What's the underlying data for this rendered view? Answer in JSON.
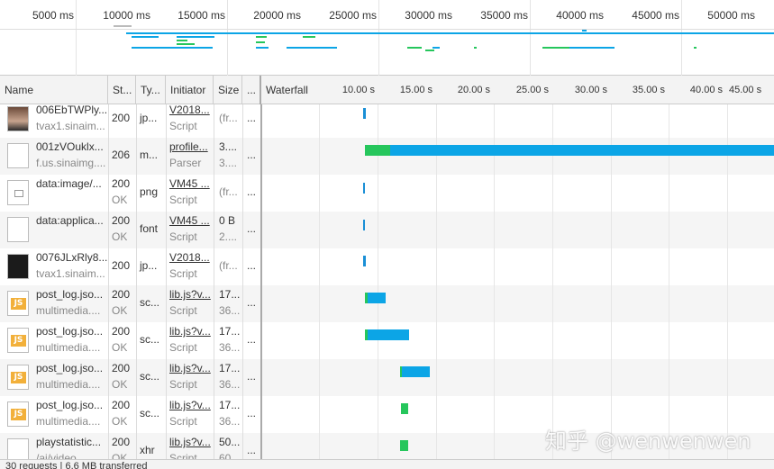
{
  "overview": {
    "ticks": [
      "5000 ms",
      "10000 ms",
      "15000 ms",
      "20000 ms",
      "25000 ms",
      "30000 ms",
      "35000 ms",
      "40000 ms",
      "45000 ms",
      "50000 ms"
    ]
  },
  "columns": {
    "name": "Name",
    "status": "St...",
    "type": "Ty...",
    "initiator": "Initiator",
    "size": "Size",
    "time": "...",
    "waterfall": "Waterfall"
  },
  "waterfall_ticks": [
    "10.00 s",
    "15.00 s",
    "20.00 s",
    "25.00 s",
    "30.00 s",
    "35.00 s",
    "40.00 s",
    "45.00 s"
  ],
  "rows": [
    {
      "name": "006EbTWPly...",
      "domain": "tvax1.sinaim...",
      "status": "200",
      "status_text": "",
      "type": "jp...",
      "initiator": "V2018...",
      "initiator_type": "Script",
      "size": "(fr...",
      "size2": "",
      "time": "...",
      "thumb": "photo"
    },
    {
      "name": "001zVOuklx...",
      "domain": "f.us.sinaimg....",
      "status": "206",
      "status_text": "",
      "type": "m...",
      "initiator": "profile...",
      "initiator_type": "Parser",
      "size": "3....",
      "size2": "3....",
      "time": "...",
      "thumb": "blank"
    },
    {
      "name": "data:image/...",
      "domain": "",
      "status": "200",
      "status_text": "OK",
      "type": "png",
      "initiator": "VM45 ...",
      "initiator_type": "Script",
      "size": "(fr...",
      "size2": "",
      "time": "...",
      "thumb": "img"
    },
    {
      "name": "data:applica...",
      "domain": "",
      "status": "200",
      "status_text": "OK",
      "type": "font",
      "initiator": "VM45 ...",
      "initiator_type": "Script",
      "size": "0 B",
      "size2": "2....",
      "time": "...",
      "thumb": "blank"
    },
    {
      "name": "0076JLxRly8...",
      "domain": "tvax1.sinaim...",
      "status": "200",
      "status_text": "",
      "type": "jp...",
      "initiator": "V2018...",
      "initiator_type": "Script",
      "size": "(fr...",
      "size2": "",
      "time": "...",
      "thumb": "dark"
    },
    {
      "name": "post_log.jso...",
      "domain": "multimedia....",
      "status": "200",
      "status_text": "OK",
      "type": "sc...",
      "initiator": "lib.js?v...",
      "initiator_type": "Script",
      "size": "17...",
      "size2": "36...",
      "time": "...",
      "thumb": "js"
    },
    {
      "name": "post_log.jso...",
      "domain": "multimedia....",
      "status": "200",
      "status_text": "OK",
      "type": "sc...",
      "initiator": "lib.js?v...",
      "initiator_type": "Script",
      "size": "17...",
      "size2": "36...",
      "time": "...",
      "thumb": "js"
    },
    {
      "name": "post_log.jso...",
      "domain": "multimedia....",
      "status": "200",
      "status_text": "OK",
      "type": "sc...",
      "initiator": "lib.js?v...",
      "initiator_type": "Script",
      "size": "17...",
      "size2": "36...",
      "time": "...",
      "thumb": "js"
    },
    {
      "name": "post_log.jso...",
      "domain": "multimedia....",
      "status": "200",
      "status_text": "OK",
      "type": "sc...",
      "initiator": "lib.js?v...",
      "initiator_type": "Script",
      "size": "17...",
      "size2": "36...",
      "time": "...",
      "thumb": "js"
    },
    {
      "name": "playstatistic...",
      "domain": "/ai/video",
      "status": "200",
      "status_text": "OK",
      "type": "xhr",
      "initiator": "lib.js?v...",
      "initiator_type": "Script",
      "size": "50...",
      "size2": "60...",
      "time": "...",
      "thumb": "blank"
    }
  ],
  "colors": {
    "receive": "#0ca5e6",
    "waiting": "#26c65c"
  },
  "status_bar": "30 requests | 6.6 MB transferred",
  "watermark": "知乎 @wenwenwen"
}
